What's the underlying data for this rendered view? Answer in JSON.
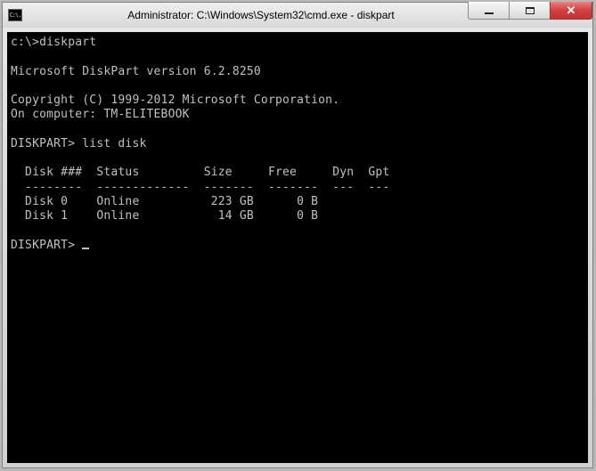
{
  "window": {
    "title": "Administrator: C:\\Windows\\System32\\cmd.exe - diskpart",
    "icon_label": "C:\\."
  },
  "terminal": {
    "prompt1": "c:\\>diskpart",
    "version_line": "Microsoft DiskPart version 6.2.8250",
    "copyright": "Copyright (C) 1999-2012 Microsoft Corporation.",
    "computer_line": "On computer: TM-ELITEBOOK",
    "prompt2": "DISKPART> list disk",
    "table_header": "  Disk ###  Status         Size     Free     Dyn  Gpt",
    "table_divider": "  --------  -------------  -------  -------  ---  ---",
    "disk_row_0": "  Disk 0    Online          223 GB      0 B",
    "disk_row_1": "  Disk 1    Online           14 GB      0 B",
    "prompt3": "DISKPART> "
  }
}
